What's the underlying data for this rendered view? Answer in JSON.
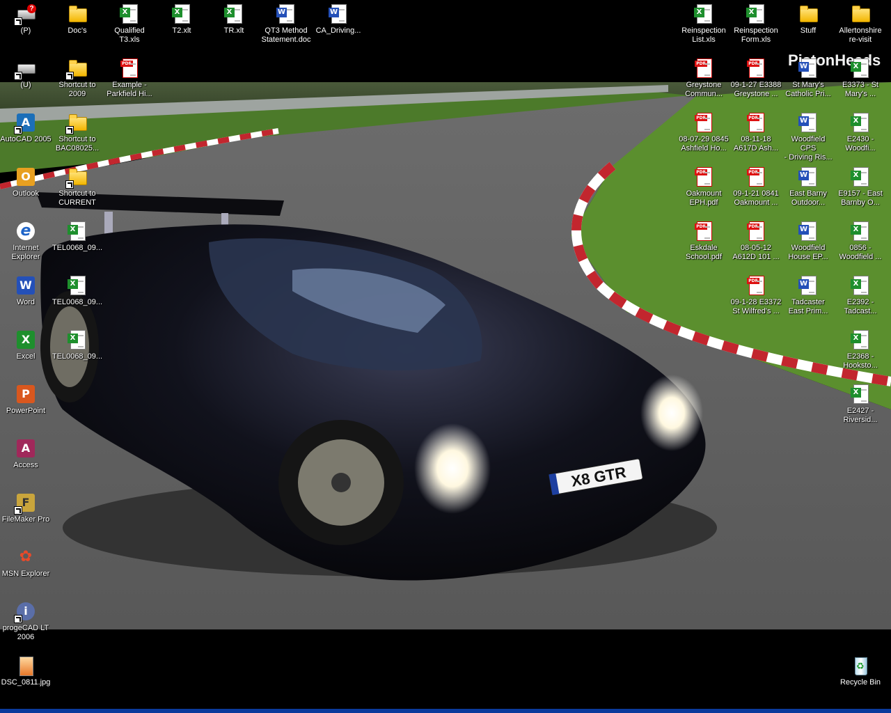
{
  "desktop": {
    "brand_text": "PistonHeads",
    "wallpaper_plate": "X8 GTR",
    "icons": {
      "p_drive": "(P)",
      "docs": "Doc's",
      "qualified_t3": "Qualified\nT3.xls",
      "t2": "T2.xlt",
      "tr": "TR.xlt",
      "qt3_method": "QT3 Method\nStatement.doc",
      "ca_driving": "CA_Driving...",
      "reinspection_list": "Reinspection\nList.xls",
      "reinspection_form": "Reinspection\nForm.xls",
      "stuff": "Stuff",
      "allertonshire": "Allertonshire\nre-visit",
      "u_drive": "(U)",
      "shortcut_2009": "Shortcut to\n2009",
      "example_parkfield": "Example -\nParkfield Hi...",
      "greystone_commun": "Greystone\nCommun...",
      "greystone_0927": "09-1-27 E3388\nGreystone ...",
      "st_marys_catholic": "St Mary's\nCatholic Pri...",
      "e3373": "E3373 - St\nMary's ...",
      "autocad": "AutoCAD 2005",
      "shortcut_bac": "Shortcut to\nBAC08025...",
      "ashfield": "08-07-29 0845\nAshfield Ho...",
      "a617d": "08-11-18\nA617D Ash...",
      "woodfield_cps": "Woodfield CPS\n- Driving Ris...",
      "e2430": "E2430 -\nWoodfi...",
      "outlook": "Outlook",
      "shortcut_current": "Shortcut to\nCURRENT",
      "oakmount_eph": "Oakmount\nEPH.pdf",
      "oakmount_0841": "09-1-21 0841\nOakmount ...",
      "east_barny": "East Barny\nOutdoor...",
      "e9157": "E9157 - East\nBarnby O...",
      "ie": "Internet\nExplorer",
      "tel1": "TEL0068_09...",
      "eskdale": "Eskdale\nSchool.pdf",
      "a612d": "08-05-12\nA612D 101 ...",
      "woodfield_house": "Woodfield\nHouse EP...",
      "woodfield_0856": "0856 -\nWoodfield ...",
      "word": "Word",
      "tel2": "TEL0068_09...",
      "st_wilfreds": "09-1-28 E3372\nSt Wilfred's ...",
      "tadcaster": "Tadcaster\nEast Prim...",
      "e2392": "E2392 -\nTadcast...",
      "excel": "Excel",
      "tel3": "TEL0068_09...",
      "e2368": "E2368 -\nHooksto...",
      "powerpoint": "PowerPoint",
      "e2427": "E2427 -\nRiversid...",
      "access": "Access",
      "filemaker": "FileMaker Pro",
      "msn": "MSN Explorer",
      "progecad": "progeCAD LT\n2006",
      "dsc": "DSC_0811.jpg",
      "recycle": "Recycle Bin"
    }
  }
}
